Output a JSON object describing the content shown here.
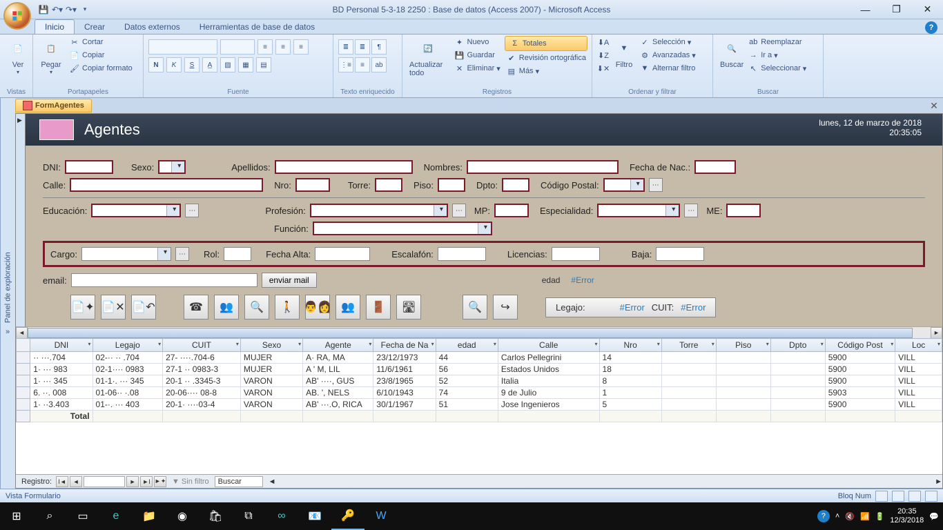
{
  "title": "BD Personal 5-3-18 2250 : Base de datos (Access 2007)  -  Microsoft Access",
  "menu": {
    "tabs": [
      "Inicio",
      "Crear",
      "Datos externos",
      "Herramientas de base de datos"
    ],
    "active": 0
  },
  "ribbon": {
    "vistas": {
      "label": "Vistas",
      "ver": "Ver"
    },
    "portapapeles": {
      "label": "Portapapeles",
      "pegar": "Pegar",
      "cortar": "Cortar",
      "copiar": "Copiar",
      "copiar_formato": "Copiar formato"
    },
    "fuente": {
      "label": "Fuente"
    },
    "texto": {
      "label": "Texto enriquecido"
    },
    "registros": {
      "label": "Registros",
      "actualizar": "Actualizar todo",
      "nuevo": "Nuevo",
      "guardar": "Guardar",
      "eliminar": "Eliminar",
      "totales": "Totales",
      "revision": "Revisión ortográfica",
      "mas": "Más"
    },
    "ordenar": {
      "label": "Ordenar y filtrar",
      "filtro": "Filtro",
      "seleccion": "Selección",
      "avanzadas": "Avanzadas",
      "alternar": "Alternar filtro"
    },
    "buscar": {
      "label": "Buscar",
      "buscar_btn": "Buscar",
      "reemplazar": "Reemplazar",
      "ira": "Ir a",
      "seleccionar": "Seleccionar"
    }
  },
  "nav_pane": "Panel de exploración",
  "form_tab": "FormAgentes",
  "form": {
    "title": "Agentes",
    "date": "lunes, 12 de marzo de 2018",
    "time": "20:35:05",
    "labels": {
      "dni": "DNI:",
      "sexo": "Sexo:",
      "apellidos": "Apellidos:",
      "nombres": "Nombres:",
      "fecha_nac": "Fecha de Nac.:",
      "calle": "Calle:",
      "nro": "Nro:",
      "torre": "Torre:",
      "piso": "Piso:",
      "dpto": "Dpto:",
      "cp": "Código Postal:",
      "educacion": "Educación:",
      "profesion": "Profesión:",
      "mp": "MP:",
      "especialidad": "Especialidad:",
      "me": "ME:",
      "funcion": "Función:",
      "cargo": "Cargo:",
      "rol": "Rol:",
      "fecha_alta": "Fecha Alta:",
      "escalafon": "Escalafón:",
      "licencias": "Licencias:",
      "baja": "Baja:",
      "email": "email:",
      "enviar": "enviar mail",
      "edad": "edad",
      "legajo": "Legajo:",
      "cuit": "CUIT:"
    },
    "error": "#Error"
  },
  "datasheet": {
    "columns": [
      "DNI",
      "Legajo",
      "CUIT",
      "Sexo",
      "Agente",
      "Fecha de Na",
      "edad",
      "Calle",
      "Nro",
      "Torre",
      "Piso",
      "Dpto",
      "Código Post",
      "Loc"
    ],
    "rows": [
      {
        "dni": "··  ···.704",
        "legajo": "02-·· ·· .704",
        "cuit": "27- ····.704-6",
        "sexo": "MUJER",
        "agente": "A·       RA, MA",
        "fecha": "23/12/1973",
        "edad": "44",
        "calle": "Carlos Pellegrini",
        "nro": "14",
        "torre": "",
        "piso": "",
        "dpto": "",
        "cp": "5900",
        "loc": "VILL"
      },
      {
        "dni": "1· ··· 983",
        "legajo": "02-1···· 0983",
        "cuit": "27-1 ·· 0983-3",
        "sexo": "MUJER",
        "agente": "A         ' M, LIL",
        "fecha": "11/6/1961",
        "edad": "56",
        "calle": "Estados Unidos",
        "nro": "18",
        "torre": "",
        "piso": "",
        "dpto": "",
        "cp": "5900",
        "loc": "VILL"
      },
      {
        "dni": "1· ··· 345",
        "legajo": "01-1·. ··· 345",
        "cuit": "20-1 ·· .3345-3",
        "sexo": "VARON",
        "agente": "AB' ····, GUS",
        "fecha": "23/8/1965",
        "edad": "52",
        "calle": "Italia",
        "nro": "8",
        "torre": "",
        "piso": "",
        "dpto": "",
        "cp": "5900",
        "loc": "VILL"
      },
      {
        "dni": "6. ··. 008",
        "legajo": "01-06·· ·.08",
        "cuit": "20-06···· 08-8",
        "sexo": "VARON",
        "agente": "AB.     ', NELS",
        "fecha": "6/10/1943",
        "edad": "74",
        "calle": "9 de Julio",
        "nro": "1",
        "torre": "",
        "piso": "",
        "dpto": "",
        "cp": "5903",
        "loc": "VILL"
      },
      {
        "dni": "1·  ··3.403",
        "legajo": "01-·. ··· 403",
        "cuit": "20-1· ····03-4",
        "sexo": "VARON",
        "agente": "AB' ···.O, RICA",
        "fecha": "30/1/1967",
        "edad": "51",
        "calle": "Jose Ingenieros",
        "nro": "5",
        "torre": "",
        "piso": "",
        "dpto": "",
        "cp": "5900",
        "loc": "VILL"
      }
    ],
    "total_label": "Total"
  },
  "rec_nav": {
    "label": "Registro:",
    "filter": "Sin filtro",
    "search": "Buscar"
  },
  "status": {
    "left": "Vista Formulario",
    "numlock": "Bloq Num"
  },
  "taskbar": {
    "time": "20:35",
    "date": "12/3/2018"
  }
}
